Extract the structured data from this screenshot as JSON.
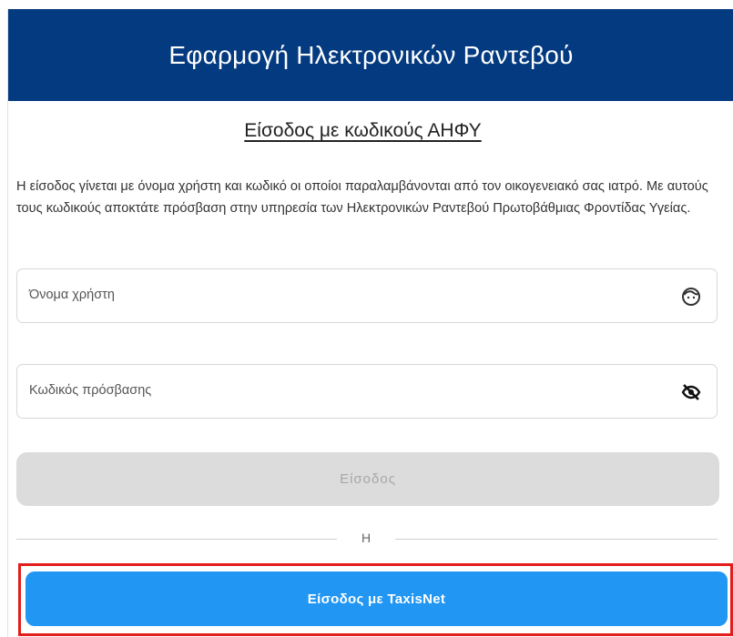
{
  "header": {
    "title": "Εφαρμογή Ηλεκτρονικών Ραντεβού"
  },
  "login": {
    "subtitle": "Είσοδος με κωδικούς ΑΗΦΥ",
    "description": "Η είσοδος γίνεται με όνομα χρήστη και κωδικό οι οποίοι παραλαμβάνονται από τον οικογενειακό σας ιατρό. Με αυτούς τους κωδικούς αποκτάτε πρόσβαση στην υπηρεσία των Ηλεκτρονικών Ραντεβού Πρωτοβάθμιας Φροντίδας Υγείας.",
    "username_placeholder": "Όνομα χρήστη",
    "username_icon": "face-icon",
    "password_placeholder": "Κωδικός πρόσβασης",
    "password_icon": "visibility-off-icon",
    "submit_label": "Είσοδος",
    "divider_text": "Η",
    "taxisnet_label": "Είσοδος με TaxisNet"
  },
  "colors": {
    "header_bg": "#043a80",
    "primary_button": "#2196f3",
    "disabled_button": "#dcdcdc",
    "highlight_border": "#e31c1c"
  }
}
